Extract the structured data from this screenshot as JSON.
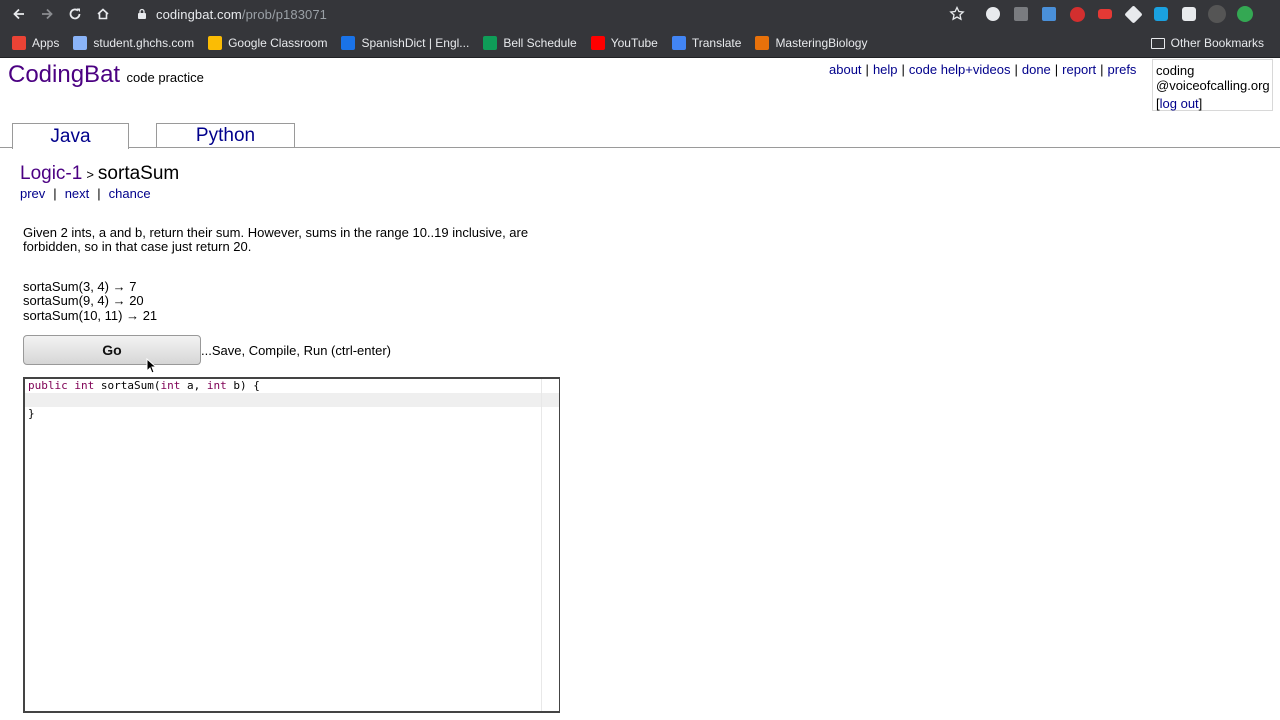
{
  "browser": {
    "url_host": "codingbat.com",
    "url_path": "/prob/p183071"
  },
  "bookmarks": [
    {
      "label": "Apps",
      "icon": "apps-grid-icon",
      "color": "#ea4335"
    },
    {
      "label": "student.ghchs.com",
      "icon": "folder-icon",
      "color": "#8ab4f8"
    },
    {
      "label": "Google Classroom",
      "icon": "google-classroom-icon",
      "color": "#fbbc04"
    },
    {
      "label": "SpanishDict | Engl...",
      "icon": "spanishdict-icon",
      "color": "#1a73e8"
    },
    {
      "label": "Bell Schedule",
      "icon": "bell-schedule-icon",
      "color": "#0f9d58"
    },
    {
      "label": "YouTube",
      "icon": "youtube-icon",
      "color": "#ff0000"
    },
    {
      "label": "Translate",
      "icon": "translate-icon",
      "color": "#4285f4"
    },
    {
      "label": "MasteringBiology",
      "icon": "masteringbiology-icon",
      "color": "#e8710a"
    }
  ],
  "bookmarks_other": "Other Bookmarks",
  "site": {
    "brand": "CodingBat",
    "tagline": "code practice",
    "links": [
      "about",
      "help",
      "code help+videos",
      "done",
      "report",
      "prefs"
    ],
    "user": {
      "line1": "coding",
      "line2": "@voiceofcalling.org",
      "logout": "log out"
    }
  },
  "tabs": {
    "java": "Java",
    "python": "Python"
  },
  "problem": {
    "section": "Logic-1",
    "gt": ">",
    "name": "sortaSum",
    "nav": [
      "prev",
      "next",
      "chance"
    ],
    "description": "Given 2 ints, a and b, return their sum. However, sums in the range 10..19 inclusive, are forbidden, so in that case just return 20.",
    "examples": [
      "sortaSum(3, 4) → 7",
      "sortaSum(9, 4) → 20",
      "sortaSum(10, 11) → 21"
    ]
  },
  "go": {
    "label": "Go",
    "hint": "...Save, Compile, Run (ctrl-enter)"
  },
  "editor": {
    "line1_kw1": "public",
    "line1_kw2": "int",
    "line1_fn": " sortaSum(",
    "line1_kw3": "int",
    "line1_a": " a, ",
    "line1_kw4": "int",
    "line1_b": " b) {",
    "line2": "",
    "line3": "}"
  }
}
